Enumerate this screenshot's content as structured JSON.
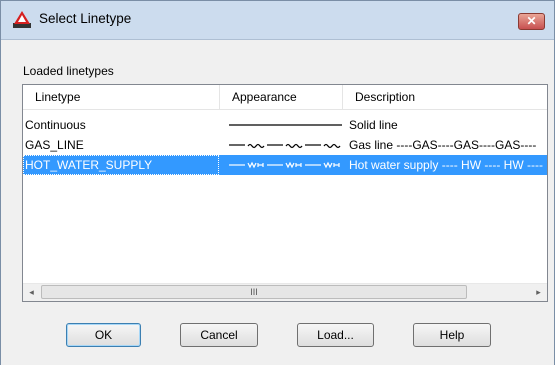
{
  "window": {
    "title": "Select Linetype",
    "close_label": "✕",
    "app_icon": "autocad-logo-icon",
    "close_color": "#c75050"
  },
  "section_label": "Loaded linetypes",
  "columns": [
    "Linetype",
    "Appearance",
    "Description"
  ],
  "rows": [
    {
      "name": "Continuous",
      "appearance": "solid",
      "description": "Solid line",
      "selected": false
    },
    {
      "name": "GAS_LINE",
      "appearance": "gas",
      "description": "Gas line ----GAS----GAS----GAS----",
      "selected": false
    },
    {
      "name": "HOT_WATER_SUPPLY",
      "appearance": "hw",
      "description": "Hot water supply ---- HW ---- HW ----",
      "selected": true
    }
  ],
  "scrollbar": {
    "left_arrow": "◂",
    "right_arrow": "▸",
    "thumb_grip": "III"
  },
  "buttons": {
    "ok": "OK",
    "cancel": "Cancel",
    "load": "Load...",
    "help": "Help"
  },
  "selection_color": "#3399ff"
}
